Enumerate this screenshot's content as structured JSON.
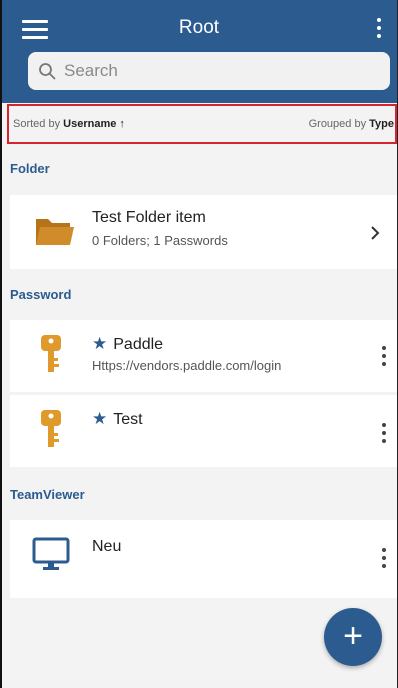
{
  "header": {
    "title": "Root",
    "menu_icon": "hamburger-menu-icon",
    "more_icon": "more-vertical-icon"
  },
  "search": {
    "placeholder": "Search",
    "icon": "search-icon"
  },
  "sort_bar": {
    "sorted_prefix": "Sorted by",
    "sorted_value": "Username ↑",
    "grouped_prefix": "Grouped by",
    "grouped_value": "Type"
  },
  "sections": {
    "folder": {
      "title": "Folder",
      "items": [
        {
          "title": "Test Folder item",
          "subtitle": "0 Folders; 1 Passwords",
          "icon": "folder-icon"
        }
      ]
    },
    "password": {
      "title": "Password",
      "items": [
        {
          "title": "Paddle",
          "subtitle": "Https://vendors.paddle.com/login",
          "favorite": true,
          "icon": "key-icon"
        },
        {
          "title": "Test",
          "subtitle": "",
          "favorite": true,
          "icon": "key-icon"
        }
      ]
    },
    "teamviewer": {
      "title": "TeamViewer",
      "items": [
        {
          "title": "Neu",
          "subtitle": "",
          "icon": "monitor-icon"
        }
      ]
    }
  },
  "fab": {
    "label": "+"
  },
  "colors": {
    "primary": "#2c5b8f",
    "folder": "#c8821f",
    "key": "#e09a2c",
    "highlight": "#d6242f"
  }
}
